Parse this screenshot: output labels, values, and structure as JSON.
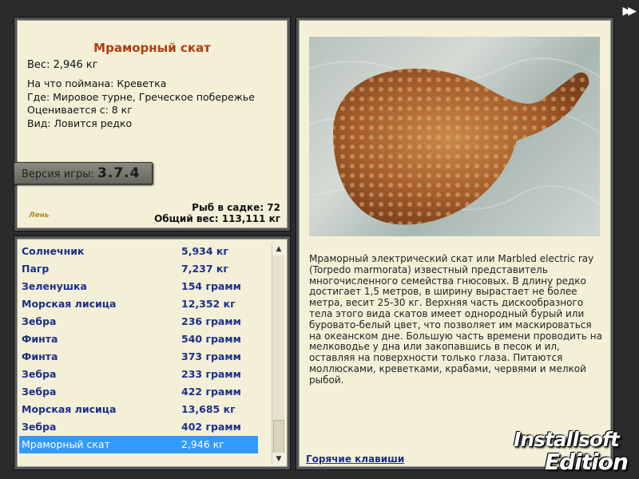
{
  "info": {
    "title": "Мраморный скат",
    "weight": "Вес: 2,946 кг",
    "caught_with": "На что поймана: Креветка",
    "location": "Где: Мировое турне, Греческое побережье",
    "value": "Оценивается с: 8 кг",
    "kind": "Вид: Ловится редко",
    "version_label": "Версия игры:",
    "version_value": "3.7.4",
    "fish_in_cage": "Рыб в садке: 72",
    "total_weight": "Общий вес: 113,111 кг",
    "small_logo": "Лень"
  },
  "fish_list": [
    {
      "name": "Солнечник",
      "weight": "5,934 кг"
    },
    {
      "name": "Пагр",
      "weight": "7,237 кг"
    },
    {
      "name": "Зеленушка",
      "weight": "154 грамм"
    },
    {
      "name": "Морская лисица",
      "weight": "12,352 кг"
    },
    {
      "name": "Зебра",
      "weight": "236 грамм"
    },
    {
      "name": "Финта",
      "weight": "540 грамм"
    },
    {
      "name": "Финта",
      "weight": "373 грамм"
    },
    {
      "name": "Зебра",
      "weight": "233 грамм"
    },
    {
      "name": "Зебра",
      "weight": "422 грамм"
    },
    {
      "name": "Морская лисица",
      "weight": "13,685 кг"
    },
    {
      "name": "Зебра",
      "weight": "402 грамм"
    },
    {
      "name": "Мраморный скат",
      "weight": "2,946 кг"
    }
  ],
  "detail": {
    "description": "Мраморный электрический скат или Marbled electric ray (Torpedo marmorata) известный представитель многочисленного семейства гнюсовых. В длину редко достигает 1,5 метров, в ширину вырастает не более метра, весит 25-30 кг. Верхняя часть дискообразного тела этого вида скатов имеет однородный бурый или буровато-белый цвет, что позволяет им маскироваться на океанском дне. Большую часть времени проводить на мелководье у дна или закопавшись в песок и ил, оставляя на поверхности только глаза. Питаются моллюсками, креветками, крабами, червями и мелкой рыбой.",
    "hotkeys": "Горячие клавиши"
  },
  "brand": {
    "line1": "Installsoft",
    "line2": "Edition"
  },
  "nav": {
    "next": "▶▶"
  }
}
